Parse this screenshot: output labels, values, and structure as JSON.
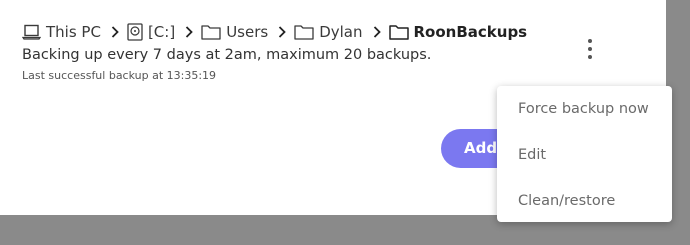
{
  "breadcrumb": {
    "items": [
      {
        "label": "This PC",
        "icon": "laptop-icon"
      },
      {
        "label": "[C:]",
        "icon": "disk-icon"
      },
      {
        "label": "Users",
        "icon": "folder-icon"
      },
      {
        "label": "Dylan",
        "icon": "folder-icon"
      },
      {
        "label": "RoonBackups",
        "icon": "folder-icon"
      }
    ],
    "separator_icon": "chevron-right-icon"
  },
  "schedule_text": "Backing up every 7 days at 2am, maximum 20 backups.",
  "last_backup_text": "Last successful backup at 13:35:19",
  "more_button_icon": "more-vertical-icon",
  "add_button_label": "Add",
  "menu": {
    "items": [
      "Force backup now",
      "Edit",
      "Clean/restore"
    ]
  },
  "colors": {
    "accent": "#7b78f0",
    "overlay": "#8a8a8a"
  }
}
